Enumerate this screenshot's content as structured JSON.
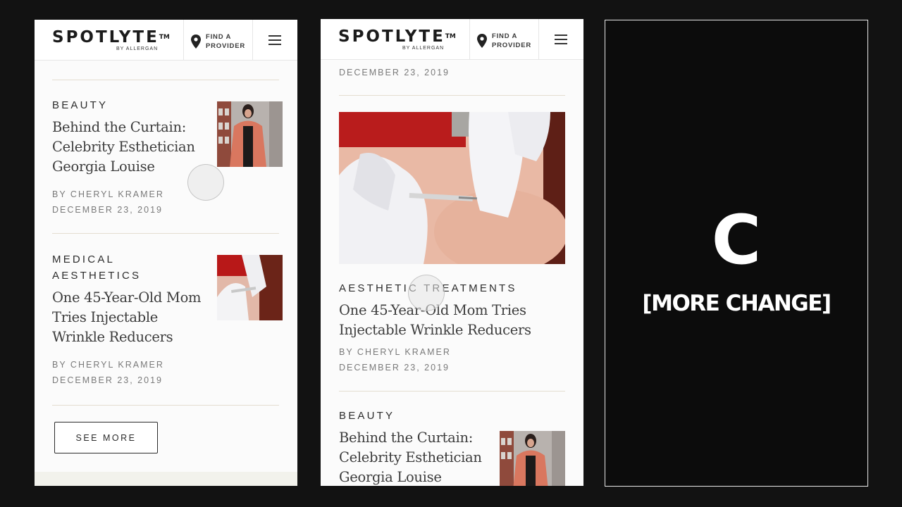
{
  "brand": {
    "logo": "SPOTLYTE",
    "trademark": "TM",
    "byline": "BY ALLERGAN",
    "find_provider_line1": "FIND A",
    "find_provider_line2": "PROVIDER"
  },
  "left_screen": {
    "articles": [
      {
        "category": "BEAUTY",
        "title_lines": [
          "Behind the Curtain:",
          "Celebrity Esthetician",
          "Georgia Louise"
        ],
        "author": "BY CHERYL KRAMER",
        "date": "DECEMBER 23, 2019",
        "thumb": "woman-in-pink-fur-coat"
      },
      {
        "category_lines": [
          "MEDICAL",
          "AESTHETICS"
        ],
        "title_lines": [
          "One 45-Year-Old Mom",
          "Tries Injectable",
          "Wrinkle Reducers"
        ],
        "author": "BY CHERYL KRAMER",
        "date": "DECEMBER 23, 2019",
        "thumb": "gloved-injection-closeup"
      }
    ],
    "see_more": "SEE MORE"
  },
  "middle_screen": {
    "top_date": "DECEMBER 23, 2019",
    "featured": {
      "category": "AESTHETIC TREATMENTS",
      "title_lines": [
        "One 45-Year-Old Mom Tries",
        "Injectable Wrinkle Reducers"
      ],
      "author": "BY CHERYL KRAMER",
      "date": "DECEMBER 23, 2019"
    },
    "next": {
      "category": "BEAUTY",
      "title_lines": [
        "Behind the Curtain:",
        "Celebrity Esthetician",
        "Georgia Louise"
      ]
    }
  },
  "right_panel": {
    "letter": "C",
    "caption": "[MORE CHANGE]"
  },
  "colors": {
    "page_bg": "#121212",
    "screen_bg": "#fbfbfb",
    "rule": "#e4ddd0",
    "text_dark": "#2c2c2c",
    "meta_gray": "#7a7a7a"
  }
}
